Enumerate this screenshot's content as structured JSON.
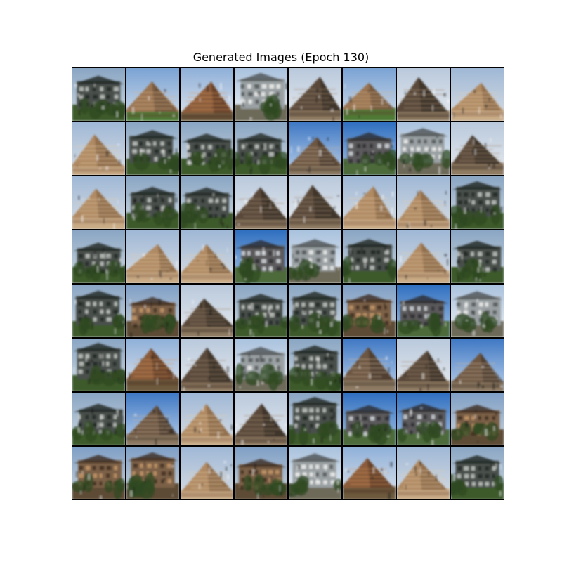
{
  "figure": {
    "title": "Generated Images (Epoch 130)"
  },
  "grid": {
    "rows": 8,
    "columns": 8,
    "tiles": [
      [
        "building-trees",
        "pyramid-grass",
        "pyramid-ruins",
        "building-white",
        "pyramid-dark",
        "pyramid-grass",
        "pyramid-dark",
        "pyramid-sand"
      ],
      [
        "pyramid-sand",
        "building-trees",
        "building-trees",
        "building-trees",
        "pyramid-blue",
        "building-blue",
        "building-white",
        "pyramid-dark"
      ],
      [
        "pyramid-sand",
        "building-trees",
        "building-trees",
        "pyramid-dark",
        "pyramid-dark",
        "pyramid-sand",
        "pyramid-sand",
        "building-trees"
      ],
      [
        "building-trees",
        "pyramid-sand",
        "pyramid-sand",
        "building-blue",
        "building-white",
        "building-trees",
        "pyramid-sand",
        "building-trees"
      ],
      [
        "building-trees",
        "building-ruins",
        "pyramid-dark",
        "building-trees",
        "building-trees",
        "building-ruins",
        "building-blue",
        "building-white"
      ],
      [
        "building-trees",
        "pyramid-ruins",
        "pyramid-dark",
        "building-white",
        "building-trees",
        "pyramid-blue",
        "pyramid-dark",
        "pyramid-blue"
      ],
      [
        "building-trees",
        "pyramid-blue",
        "pyramid-sand",
        "pyramid-dark",
        "building-trees",
        "building-blue",
        "building-blue",
        "building-ruins"
      ],
      [
        "building-ruins",
        "building-ruins",
        "pyramid-sand",
        "building-ruins",
        "building-white",
        "pyramid-ruins",
        "pyramid-sand",
        "building-trees"
      ]
    ]
  },
  "palette": {
    "pyramid-sand": {
      "sky_top": "#9fb8d6",
      "sky_bottom": "#d9dde2",
      "body": "#b08a63",
      "body_dark": "#7a5a3e",
      "ground": "#c9ab86",
      "accent": "#e2c9a4"
    },
    "pyramid-dark": {
      "sky_top": "#b9c9dc",
      "sky_bottom": "#e7eaee",
      "body": "#5a4a3a",
      "body_dark": "#2e261e",
      "ground": "#8f7a62",
      "accent": "#a48f76"
    },
    "pyramid-grass": {
      "sky_top": "#7aa3d4",
      "sky_bottom": "#d3dde9",
      "body": "#9a7552",
      "body_dark": "#5b4330",
      "ground": "#4f7a35",
      "accent": "#d9b48a"
    },
    "pyramid-blue": {
      "sky_top": "#3f78c4",
      "sky_bottom": "#bcd1ea",
      "body": "#6d5643",
      "body_dark": "#3a2d22",
      "ground": "#8e7a63",
      "accent": "#c7b39a"
    },
    "pyramid-ruins": {
      "sky_top": "#8fb0d9",
      "sky_bottom": "#dfe4ea",
      "body": "#8a5c3b",
      "body_dark": "#4a2e1c",
      "ground": "#6d5a3c",
      "accent": "#d69a62"
    },
    "building-trees": {
      "sky_top": "#8aa6c4",
      "sky_bottom": "#cfd8de",
      "body": "#4a4f4c",
      "body_dark": "#1e2420",
      "ground": "#3c5a2a",
      "accent": "#c8ccc8"
    },
    "building-white": {
      "sky_top": "#a9c2de",
      "sky_bottom": "#eef0f2",
      "body": "#9aa0a3",
      "body_dark": "#4d5254",
      "ground": "#6e6a5a",
      "accent": "#f2f2f0"
    },
    "building-blue": {
      "sky_top": "#2f6fc0",
      "sky_bottom": "#a8c4e4",
      "body": "#5b5a5c",
      "body_dark": "#2a2a2e",
      "ground": "#4e6b3a",
      "accent": "#d8dde2"
    },
    "building-ruins": {
      "sky_top": "#7f9fc6",
      "sky_bottom": "#cdd4d9",
      "body": "#7c6046",
      "body_dark": "#3b2b1f",
      "ground": "#5d4c34",
      "accent": "#c89a6a"
    }
  }
}
